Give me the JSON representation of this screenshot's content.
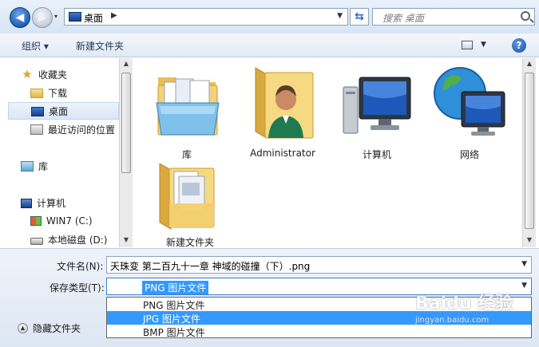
{
  "address": {
    "location": "桌面",
    "search_placeholder": "搜索 桌面"
  },
  "toolbar": {
    "organize_label": "组织 ▾",
    "new_folder_label": "新建文件夹"
  },
  "nav": {
    "items": [
      {
        "label": "收藏夹",
        "icon": "star-icon"
      },
      {
        "label": "下载",
        "icon": "folder-icon"
      },
      {
        "label": "桌面",
        "icon": "desktop-icon",
        "selected": true
      },
      {
        "label": "最近访问的位置",
        "icon": "recent-places-icon"
      },
      {
        "label": "库",
        "icon": "library-icon"
      },
      {
        "label": "计算机",
        "icon": "computer-icon"
      },
      {
        "label": "WIN7 (C:)",
        "icon": "windows-drive-icon"
      },
      {
        "label": "本地磁盘 (D:)",
        "icon": "disk-icon"
      }
    ]
  },
  "content": {
    "items": [
      {
        "label": "库",
        "icon": "library-folder-icon"
      },
      {
        "label": "Administrator",
        "icon": "user-folder-icon"
      },
      {
        "label": "计算机",
        "icon": "computer-icon"
      },
      {
        "label": "网络",
        "icon": "network-icon"
      },
      {
        "label": "新建文件夹",
        "icon": "folder-icon"
      }
    ]
  },
  "save": {
    "filename_label": "文件名(N):",
    "filename_value": "天珠变 第二百九十一章 神域的碰撞（下）.png",
    "type_label": "保存类型(T):",
    "type_value": "PNG 图片文件",
    "type_options": [
      "PNG 图片文件",
      "JPG 图片文件",
      "BMP 图片文件"
    ],
    "selected_option_index": 1,
    "hide_folders_label": "隐藏文件夹"
  },
  "watermark": {
    "text": "Baidu 经验",
    "sub": "jingyan.baidu.com"
  },
  "colors": {
    "selection": "#3399ff",
    "toolbar_text": "#1e395b"
  }
}
